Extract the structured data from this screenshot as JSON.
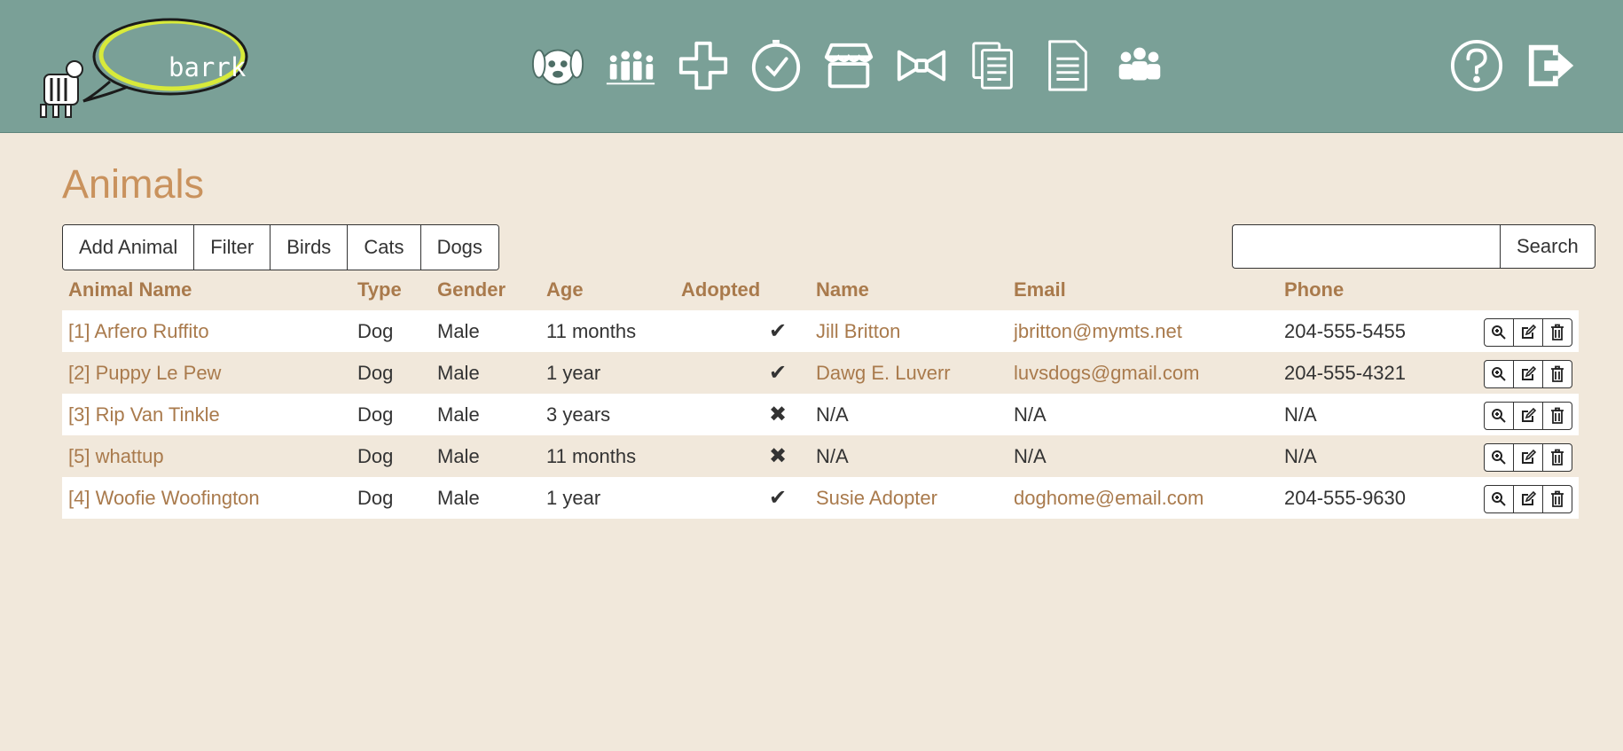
{
  "header": {
    "logo_text": "barrk",
    "nav": [
      "dog-face-icon",
      "family-icon",
      "medical-cross-icon",
      "clock-icon",
      "store-icon",
      "bow-tie-icon",
      "documents-icon",
      "document-icon",
      "people-group-icon"
    ],
    "right": [
      "help-icon",
      "logout-icon"
    ],
    "bg": "#7aa097"
  },
  "page": {
    "title": "Animals"
  },
  "toolbar": {
    "add_label": "Add Animal",
    "filter_label": "Filter",
    "birds_label": "Birds",
    "cats_label": "Cats",
    "dogs_label": "Dogs",
    "search_label": "Search",
    "search_value": ""
  },
  "table": {
    "headers": {
      "animal_name": "Animal Name",
      "type": "Type",
      "gender": "Gender",
      "age": "Age",
      "adopted": "Adopted",
      "name": "Name",
      "email": "Email",
      "phone": "Phone"
    },
    "rows": [
      {
        "animal": "[1] Arfero Ruffito",
        "type": "Dog",
        "gender": "Male",
        "age": "11 months",
        "adopted": "✔",
        "name": "Jill Britton",
        "email": "jbritton@mymts.net",
        "phone": "204-555-5455"
      },
      {
        "animal": "[2] Puppy Le Pew",
        "type": "Dog",
        "gender": "Male",
        "age": "1 year",
        "adopted": "✔",
        "name": "Dawg E. Luverr",
        "email": "luvsdogs@gmail.com",
        "phone": "204-555-4321"
      },
      {
        "animal": "[3] Rip Van Tinkle",
        "type": "Dog",
        "gender": "Male",
        "age": "3 years",
        "adopted": "✖",
        "name": "N/A",
        "email": "N/A",
        "phone": "N/A"
      },
      {
        "animal": "[5] whattup",
        "type": "Dog",
        "gender": "Male",
        "age": "11 months",
        "adopted": "✖",
        "name": "N/A",
        "email": "N/A",
        "phone": "N/A"
      },
      {
        "animal": "[4] Woofie Woofington",
        "type": "Dog",
        "gender": "Male",
        "age": "1 year",
        "adopted": "✔",
        "name": "Susie Adopter",
        "email": "doghome@email.com",
        "phone": "204-555-9630"
      }
    ]
  },
  "colors": {
    "accent": "#c9925d",
    "link": "#a97a4c",
    "background": "#f1e8db"
  }
}
